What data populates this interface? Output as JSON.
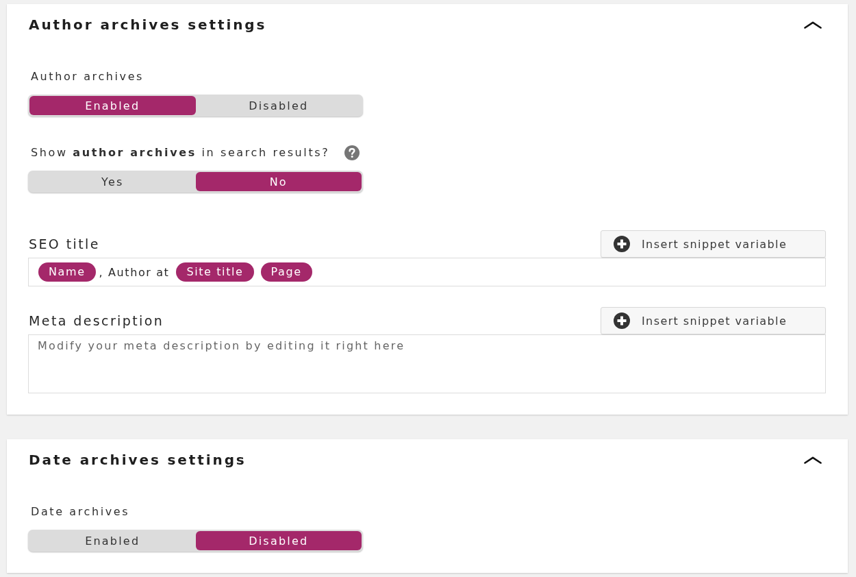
{
  "sections": [
    {
      "title": "Author archives settings",
      "expanded": true,
      "fields": [
        {
          "kind": "toggle",
          "label": "Author archives",
          "options": [
            {
              "label": "Enabled",
              "selected": true
            },
            {
              "label": "Disabled",
              "selected": false
            }
          ]
        },
        {
          "kind": "toggle",
          "label": "Show **author archives** in search results?",
          "help": true,
          "options": [
            {
              "label": "Yes",
              "selected": false
            },
            {
              "label": "No",
              "selected": true
            }
          ]
        },
        {
          "kind": "snippet_input",
          "label": "SEO title",
          "button": "Insert snippet variable",
          "value": [
            {
              "kind": "variable",
              "text": "Name"
            },
            {
              "kind": "text",
              "text": ", Author at"
            },
            {
              "kind": "variable",
              "text": "Site title"
            },
            {
              "kind": "variable",
              "text": "Page"
            }
          ]
        },
        {
          "kind": "snippet_textarea",
          "label": "Meta description",
          "button": "Insert snippet variable",
          "placeholder": "Modify your meta description by editing it right here"
        }
      ]
    },
    {
      "title": "Date archives settings",
      "expanded": true,
      "fields": [
        {
          "kind": "toggle",
          "label": "Date archives",
          "options": [
            {
              "label": "Enabled",
              "selected": false
            },
            {
              "label": "Disabled",
              "selected": true
            }
          ]
        }
      ]
    }
  ]
}
